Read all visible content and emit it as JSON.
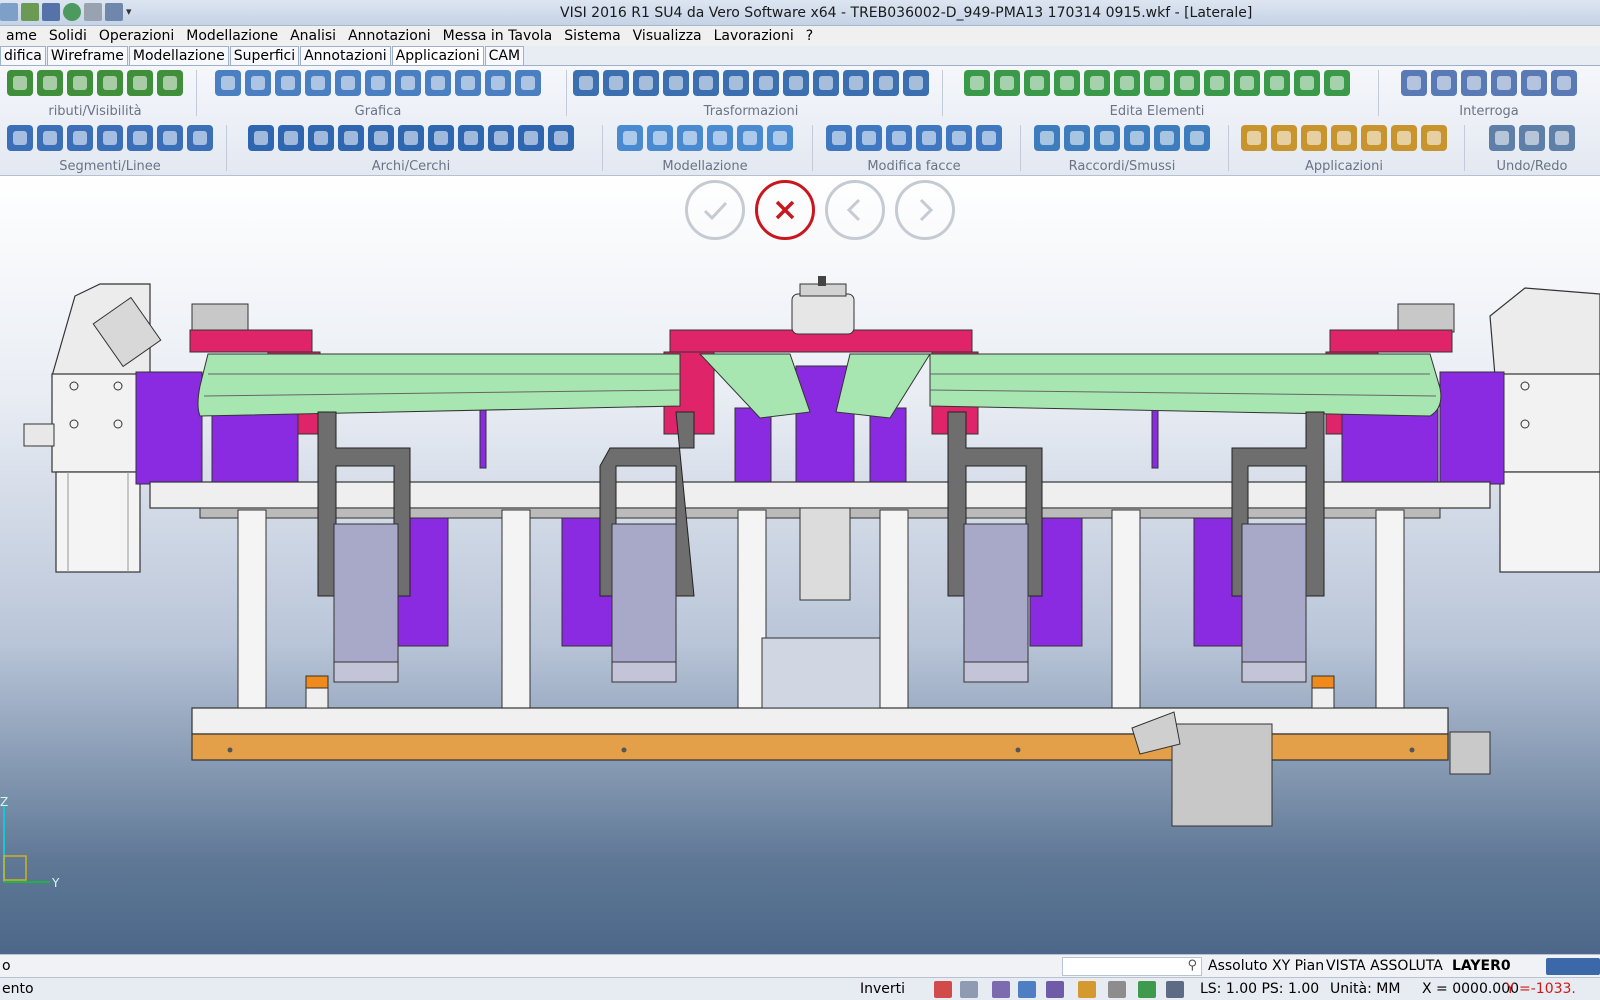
{
  "window": {
    "title": "VISI 2016 R1 SU4 da Vero Software x64 - TREB036002-D_949-PMA13 170314 0915.wkf - [Laterale]"
  },
  "menu": {
    "items": [
      "ame",
      "Solidi",
      "Operazioni",
      "Modellazione",
      "Analisi",
      "Annotazioni",
      "Messa in Tavola",
      "Sistema",
      "Visualizza",
      "Lavorazioni",
      "?"
    ]
  },
  "tabs": {
    "items": [
      "difica",
      "Wireframe",
      "Modellazione",
      "Superfici",
      "Annotazioni",
      "Applicazioni",
      "CAM"
    ],
    "active": "Applicazioni"
  },
  "ribbon": {
    "row1": [
      {
        "label": "ributi/Visibilità",
        "count": 6,
        "color": "#3f8f3b"
      },
      {
        "label": "Grafica",
        "count": 11,
        "color": "#4a7fc1"
      },
      {
        "label": "Trasformazioni",
        "count": 12,
        "color": "#3c6fb0"
      },
      {
        "label": "Edita Elementi",
        "count": 13,
        "color": "#3a9a4a"
      },
      {
        "label": "Interroga",
        "count": 6,
        "color": "#5a7ab5"
      }
    ],
    "row2": [
      {
        "label": "Segmenti/Linee",
        "count": 7,
        "color": "#3b6fb8"
      },
      {
        "label": "Archi/Cerchi",
        "count": 11,
        "color": "#2f66b0"
      },
      {
        "label": "Modellazione",
        "count": 6,
        "color": "#4a8ad0"
      },
      {
        "label": "Modifica facce",
        "count": 6,
        "color": "#3f78c0"
      },
      {
        "label": "Raccordi/Smussi",
        "count": 6,
        "color": "#3d7dbd"
      },
      {
        "label": "Applicazioni",
        "count": 7,
        "color": "#c8942e"
      },
      {
        "label": "Undo/Redo",
        "count": 3,
        "color": "#5d7fa8"
      }
    ]
  },
  "viewport": {
    "controls": [
      {
        "name": "confirm-button",
        "icon": "check-icon"
      },
      {
        "name": "cancel-button",
        "icon": "close-icon"
      },
      {
        "name": "previous-button",
        "icon": "chevron-left-icon"
      },
      {
        "name": "next-button",
        "icon": "chevron-right-icon"
      }
    ],
    "axis": {
      "z": "Z",
      "y": "Y"
    }
  },
  "status": {
    "line1_left": "o",
    "search_placeholder": "",
    "plane": "Assoluto XY Pian",
    "view": "VISTA ASSOLUTA",
    "layer": "LAYER0",
    "line2_left": "ento",
    "invert": "Inverti",
    "ls_ps": "LS: 1.00 PS: 1.00",
    "units": "Unità: MM",
    "x_coord": "X = 0000.000",
    "y_coord": "Y =-1033."
  },
  "colors": {
    "accent_cancel": "#c8171d",
    "magenta": "#e0246a",
    "purple": "#8a2be2",
    "light_green": "#a7e6b0",
    "grey_part": "#c8c8c8",
    "wood": "#e3a049"
  }
}
